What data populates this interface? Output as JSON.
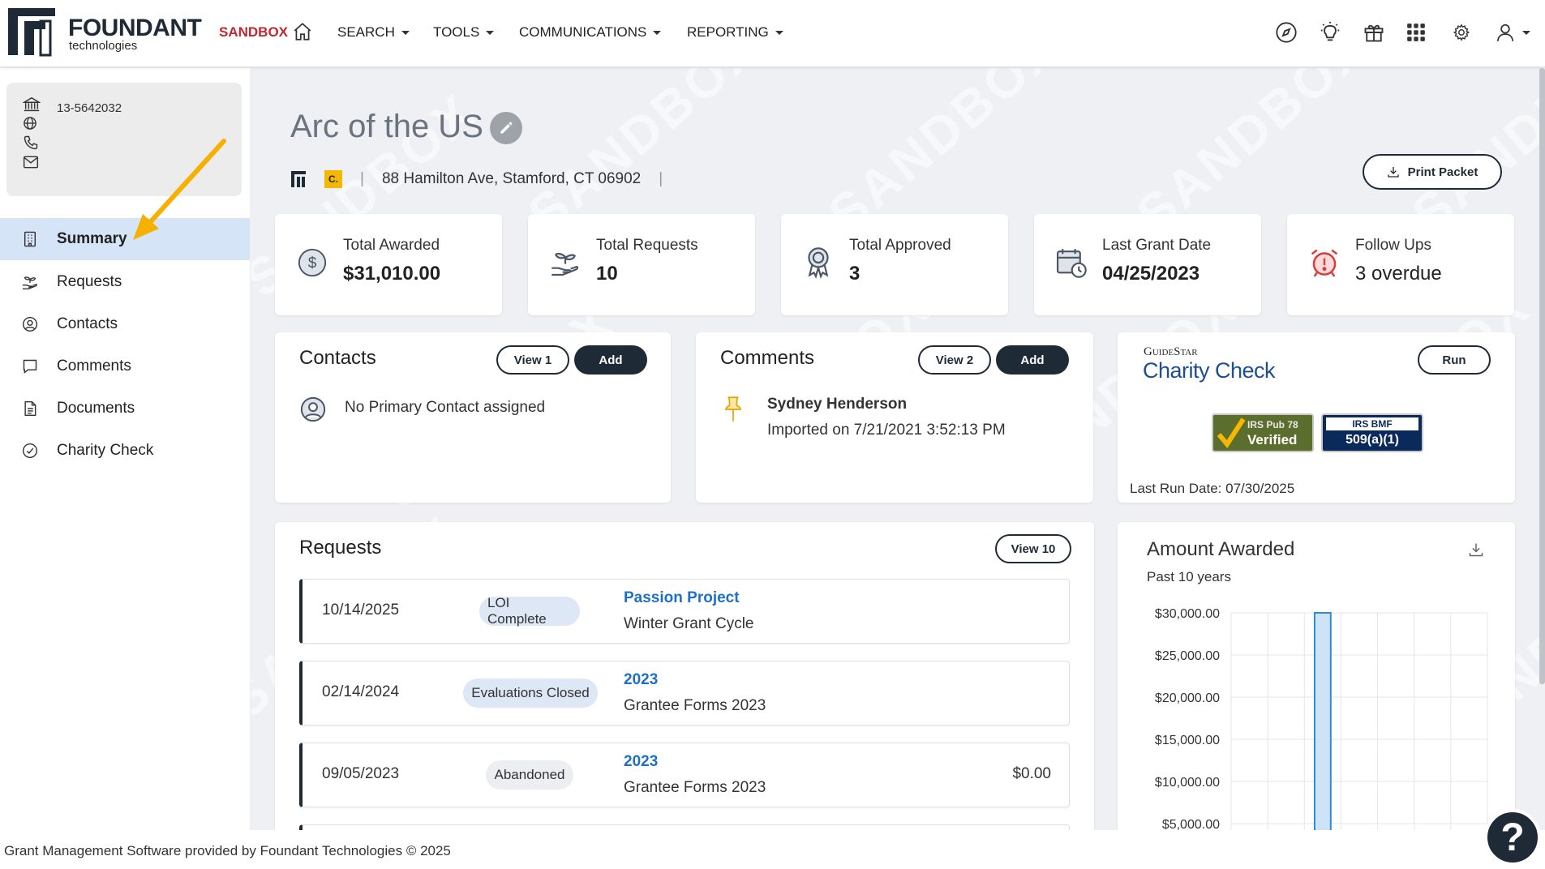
{
  "header": {
    "logo_name": "FOUNDANT",
    "logo_sub": "technologies",
    "sandbox_label": "SANDBOX",
    "nav": [
      {
        "label": "SEARCH"
      },
      {
        "label": "TOOLS"
      },
      {
        "label": "COMMUNICATIONS"
      },
      {
        "label": "REPORTING"
      }
    ],
    "icons": [
      "compass-icon",
      "lightbulb-icon",
      "gift-icon",
      "apps-grid-icon",
      "gear-icon",
      "user-icon"
    ]
  },
  "watermark_text": "SANDBOX",
  "sidebar": {
    "ein": "13-5642032",
    "items": [
      {
        "label": "Summary",
        "icon": "building-icon",
        "active": true
      },
      {
        "label": "Requests",
        "icon": "hand-seedling-icon",
        "active": false
      },
      {
        "label": "Contacts",
        "icon": "user-circle-icon",
        "active": false
      },
      {
        "label": "Comments",
        "icon": "comment-icon",
        "active": false
      },
      {
        "label": "Documents",
        "icon": "document-icon",
        "active": false
      },
      {
        "label": "Charity Check",
        "icon": "check-circle-icon",
        "active": false
      }
    ]
  },
  "org": {
    "name": "Arc of the US",
    "badge_c": "C.",
    "address": "88 Hamilton Ave, Stamford, CT 06902",
    "print_label": "Print Packet"
  },
  "stats": [
    {
      "label": "Total Awarded",
      "value": "$31,010.00",
      "icon": "dollar-circle-icon"
    },
    {
      "label": "Total Requests",
      "value": "10",
      "icon": "hand-seedling-icon"
    },
    {
      "label": "Total Approved",
      "value": "3",
      "icon": "award-ribbon-icon"
    },
    {
      "label": "Last Grant Date",
      "value": "04/25/2023",
      "icon": "calendar-clock-icon"
    },
    {
      "label": "Follow Ups",
      "value": "3 overdue",
      "icon": "alarm-clock-icon"
    }
  ],
  "contacts": {
    "title": "Contacts",
    "view_label": "View 1",
    "add_label": "Add",
    "empty_text": "No Primary Contact assigned"
  },
  "comments": {
    "title": "Comments",
    "view_label": "View 2",
    "add_label": "Add",
    "author": "Sydney Henderson",
    "meta": "Imported on 7/21/2021 3:52:13 PM"
  },
  "charity_check": {
    "guidestar_label": "GuideStar",
    "title": "Charity Check",
    "run_label": "Run",
    "badge1_top": "IRS Pub 78",
    "badge1_bottom": "Verified",
    "badge2_top": "IRS BMF",
    "badge2_bottom": "509(a)(1)",
    "last_run": "Last Run Date: 07/30/2025"
  },
  "requests": {
    "title": "Requests",
    "view_label": "View 10",
    "rows": [
      {
        "date": "10/14/2025",
        "status": "LOI Complete",
        "name": "Passion Project",
        "cycle": "Winter Grant Cycle",
        "amount": ""
      },
      {
        "date": "02/14/2024",
        "status": "Evaluations Closed",
        "name": "2023",
        "cycle": "Grantee Forms 2023",
        "amount": ""
      },
      {
        "date": "09/05/2023",
        "status": "Abandoned",
        "name": "2023",
        "cycle": "Grantee Forms 2023",
        "amount": "$0.00"
      }
    ]
  },
  "chart_data": {
    "type": "bar",
    "title": "Amount Awarded",
    "subtitle": "Past 10 years",
    "yticks": [
      "$30,000.00",
      "$25,000.00",
      "$20,000.00",
      "$15,000.00",
      "$10,000.00",
      "$5,000.00"
    ],
    "ylim": [
      0,
      30000
    ],
    "categories": [
      "",
      "",
      "",
      "",
      "",
      "",
      ""
    ],
    "values": [
      0,
      0,
      30000,
      0,
      0,
      0,
      0
    ],
    "grid": true,
    "bar_color": "#cfe3f7",
    "bar_stroke": "#2f8ad8"
  },
  "footer": {
    "text": "Grant Management Software provided by Foundant Technologies © 2025"
  },
  "help_label": "?"
}
